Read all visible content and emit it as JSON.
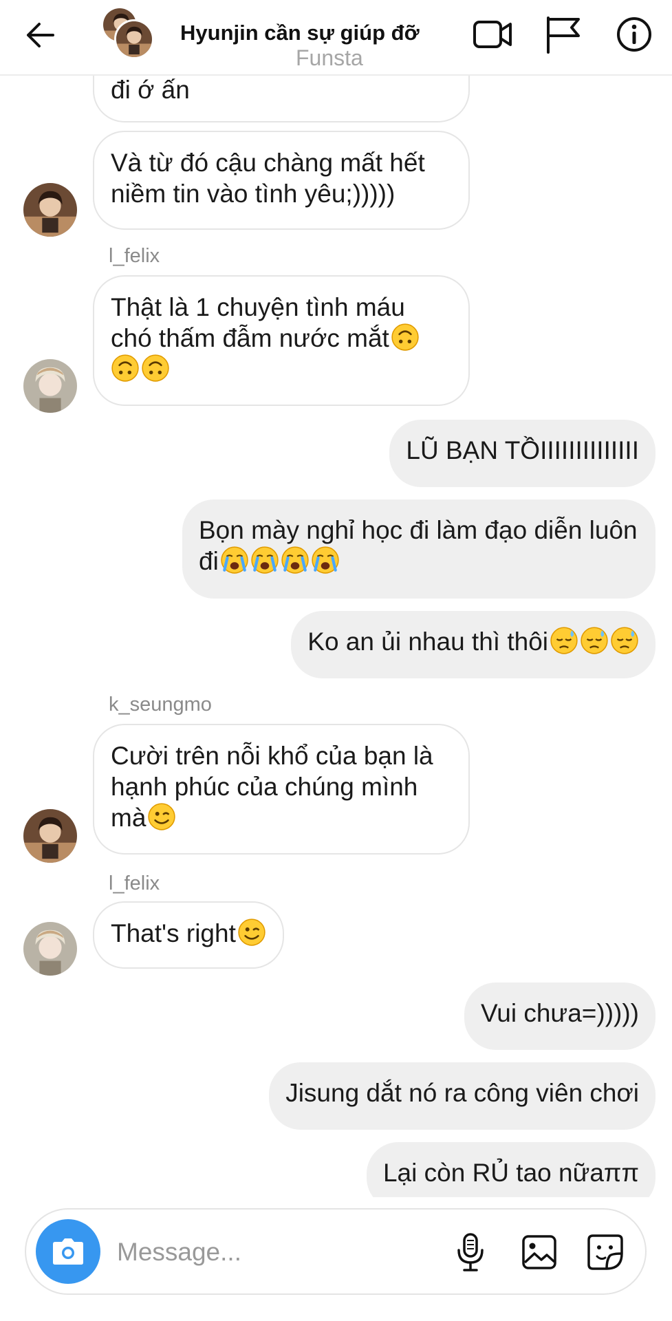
{
  "header": {
    "title": "Hyunjin cần sự giúp đỡ",
    "watermark": "Funsta",
    "icons": [
      "back-arrow-icon",
      "video-call-icon",
      "flag-icon",
      "info-icon"
    ]
  },
  "messages": {
    "m1": "đi ớ ấn",
    "m2": "Và từ đó cậu chàng mất hết niềm tin vào tình yêu;)))))",
    "s3": "l_felix",
    "m3": "Thật là 1 chuyện tình máu chó thấm đẫm nước mắt",
    "m4": "LŨ BẠN TỒIIIIIIIIIIIIII",
    "m5": "Bọn mày nghỉ học đi làm đạo diễn luôn đi",
    "m6": "Ko an ủi nhau thì thôi",
    "s7": "k_seungmo",
    "m7": "Cười trên nỗi khổ của bạn là hạnh phúc của chúng mình mà",
    "s8": "l_felix",
    "m8": "That's right",
    "m9": "Vui chưa=)))))",
    "m10": "Jisung dắt nó ra công viên chơi",
    "m11": "Lại còn RỦ tao nữaππ"
  },
  "emoji": {
    "m3": [
      "upside-down-face",
      "upside-down-face",
      "upside-down-face"
    ],
    "m5": [
      "loudly-crying-face",
      "loudly-crying-face",
      "loudly-crying-face",
      "loudly-crying-face"
    ],
    "m6": [
      "downcast-sweat-face",
      "downcast-sweat-face",
      "downcast-sweat-face"
    ],
    "m7": [
      "winking-face"
    ],
    "m8": [
      "winking-face"
    ]
  },
  "composer": {
    "placeholder": "Message..."
  },
  "colors": {
    "accent": "#3797f0",
    "incoming_bubble": "#ffffff",
    "outgoing_bubble": "#efefef",
    "emoji_yellow": "#ffcc33"
  }
}
